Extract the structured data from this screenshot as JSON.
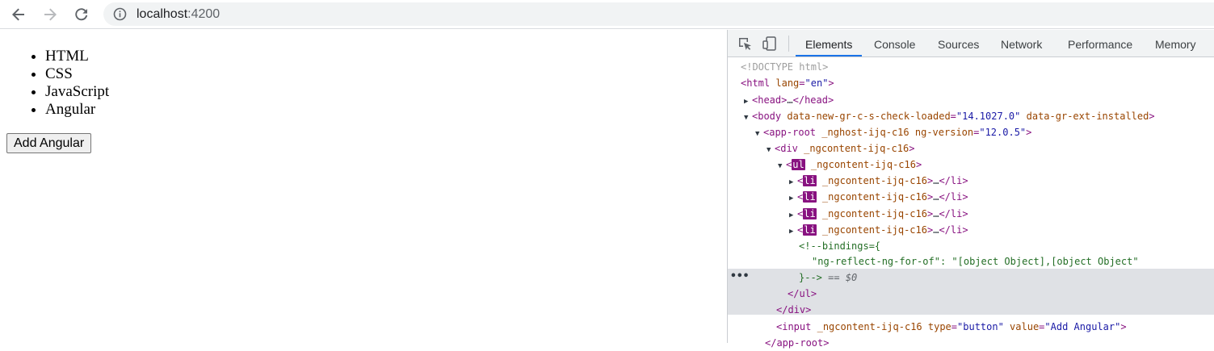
{
  "browser": {
    "url_host": "localhost",
    "url_port": ":4200"
  },
  "page": {
    "list_items": [
      "HTML",
      "CSS",
      "JavaScript",
      "Angular"
    ],
    "button_label": "Add Angular"
  },
  "devtools": {
    "tabs": [
      "Elements",
      "Console",
      "Sources",
      "Network",
      "Performance",
      "Memory"
    ],
    "active_tab": "Elements",
    "ellipsis": "•••",
    "dom": {
      "doctype": "<!DOCTYPE html>",
      "html_open": "html",
      "html_lang_attr": "lang",
      "html_lang_val": "\"en\"",
      "head": "head",
      "head_ellipsis": "…",
      "body_tag": "body",
      "body_attr1": "data-new-gr-c-s-check-loaded",
      "body_val1": "\"14.1027.0\"",
      "body_attr2": "data-gr-ext-installed",
      "approot_tag": "app-root",
      "approot_attr1": "_nghost-ijq-c16",
      "approot_attr2": "ng-version",
      "approot_val2": "\"12.0.5\"",
      "div_tag": "div",
      "ngcontent": "_ngcontent-ijq-c16",
      "ul_tag": "ul",
      "li_tag": "li",
      "li_ellipsis": "…",
      "comment_1": "<!--bindings={",
      "comment_2": "\"ng-reflect-ng-for-of\": \"[object Object],[object Object\"",
      "comment_3": "}-->",
      "eq_ref": "== $0",
      "input_tag": "input",
      "input_attr_type": "type",
      "input_val_type": "\"button\"",
      "input_attr_value": "value",
      "input_val_value": "\"Add Angular\"",
      "approot_close": "</app-root>"
    }
  }
}
